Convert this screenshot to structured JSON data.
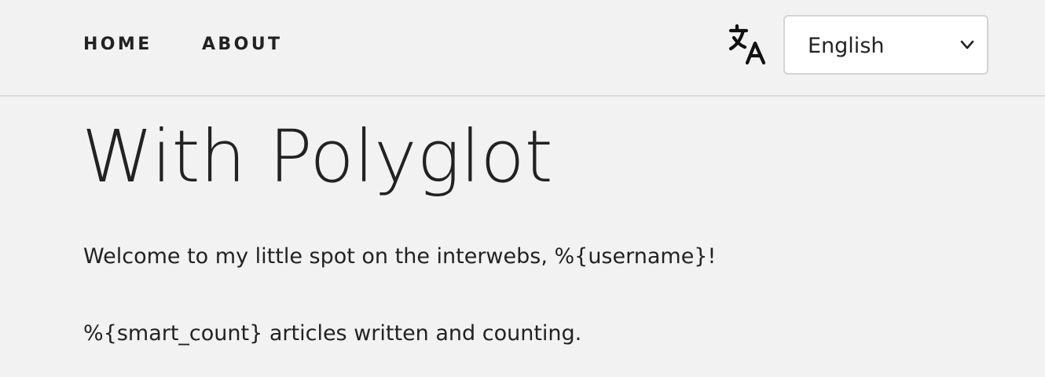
{
  "nav": {
    "home_label": "HOME",
    "about_label": "ABOUT"
  },
  "language": {
    "icon": "translate-icon",
    "selected": "English"
  },
  "main": {
    "title": "With Polyglot",
    "welcome": "Welcome to my little spot on the interwebs, %{username}!",
    "count": "%{smart_count} articles written and counting."
  },
  "colors": {
    "background": "#f2f2f2",
    "text": "#222222",
    "divider": "#dcdcdc",
    "select_border": "#d4d4d4"
  }
}
